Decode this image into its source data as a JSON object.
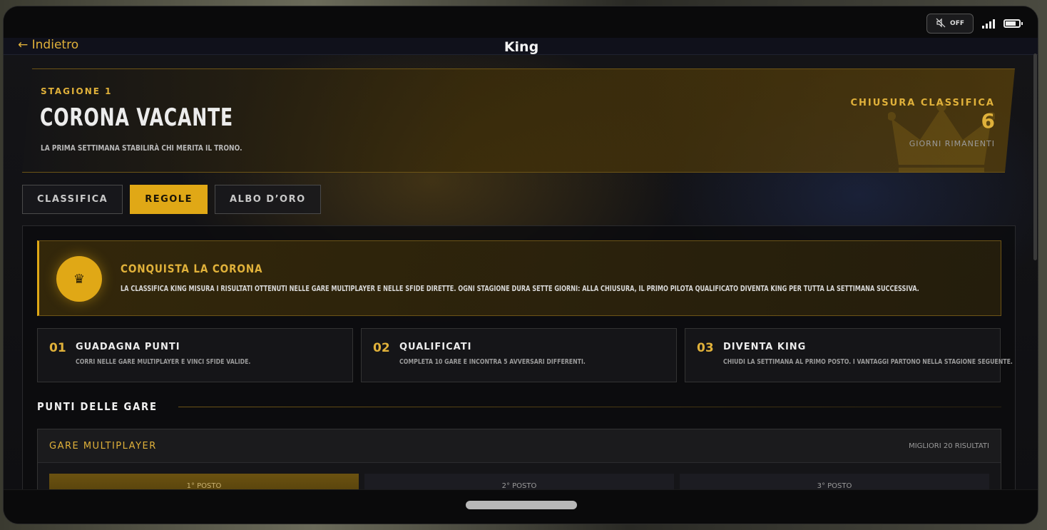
{
  "status": {
    "sound_label": "OFF",
    "signal_bars": 4,
    "battery_level": 0.8
  },
  "nav": {
    "back_label": "← Indietro",
    "title": "King"
  },
  "hero": {
    "season": "STAGIONE 1",
    "title": "CORONA VACANTE",
    "description": "LA PRIMA SETTIMANA STABILIRÀ CHI MERITA IL TRONO.",
    "close_label": "CHIUSURA CLASSIFICA",
    "close_value": "6",
    "close_sub": "GIORNI RIMANENTI"
  },
  "tabs": [
    {
      "label": "CLASSIFICA",
      "active": false
    },
    {
      "label": "REGOLE",
      "active": true
    },
    {
      "label": "ALBO D’ORO",
      "active": false
    }
  ],
  "callout": {
    "icon": "crown-icon",
    "title": "CONQUISTA LA CORONA",
    "text": "LA CLASSIFICA KING MISURA I RISULTATI OTTENUTI NELLE GARE MULTIPLAYER E NELLE SFIDE DIRETTE. OGNI STAGIONE DURA SETTE GIORNI: ALLA CHIUSURA, IL PRIMO PILOTA QUALIFICATO DIVENTA KING PER TUTTA LA SETTIMANA SUCCESSIVA."
  },
  "steps": [
    {
      "num": "01",
      "title": "GUADAGNA PUNTI",
      "text": "CORRI NELLE GARE MULTIPLAYER E VINCI SFIDE VALIDE."
    },
    {
      "num": "02",
      "title": "QUALIFICATI",
      "text": "COMPLETA 10 GARE E INCONTRA 5 AVVERSARI DIFFERENTI."
    },
    {
      "num": "03",
      "title": "DIVENTA KING",
      "text": "CHIUDI LA SETTIMANA AL PRIMO POSTO. I VANTAGGI PARTONO NELLA STAGIONE SEGUENTE."
    }
  ],
  "section": {
    "title": "PUNTI DELLE GARE"
  },
  "multiplayer": {
    "title": "GARE MULTIPLAYER",
    "note": "MIGLIORI 20 RISULTATI",
    "positions": [
      "1° POSTO",
      "2° POSTO",
      "3° POSTO"
    ]
  },
  "colors": {
    "accent": "#e0a816",
    "accent_text": "#e0b13a",
    "background": "#0b0b0c"
  }
}
